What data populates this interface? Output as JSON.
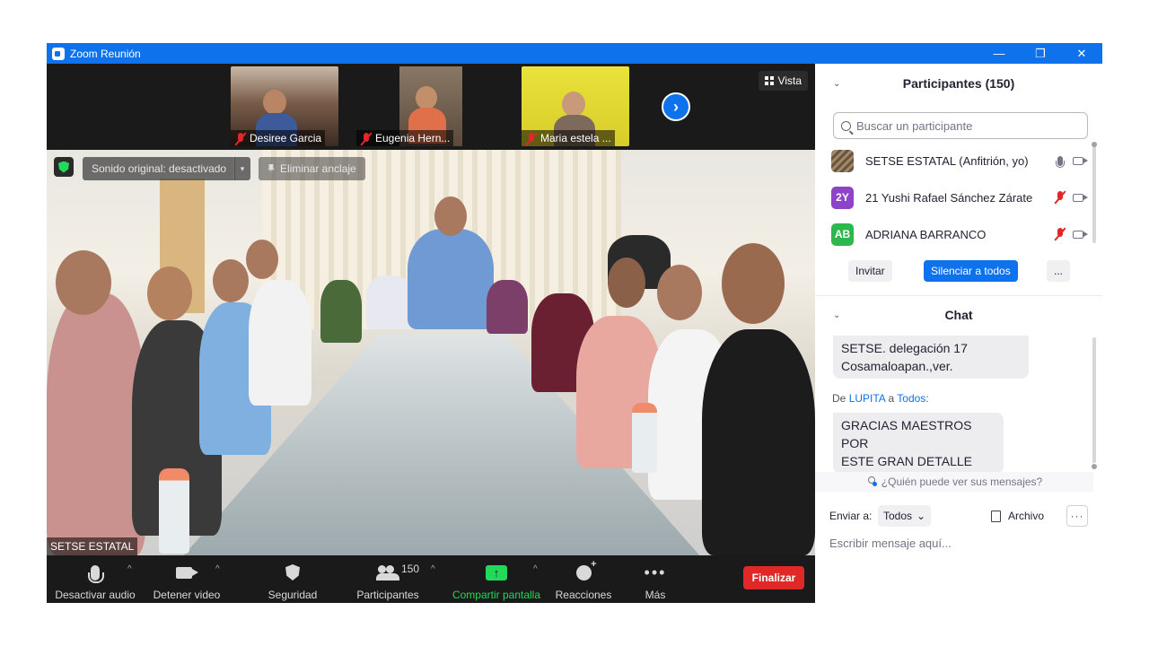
{
  "window": {
    "title": "Zoom Reunión",
    "minimize": "—",
    "maximize": "❐",
    "close": "✕"
  },
  "gallery": {
    "thumbnails": [
      {
        "name": "Desiree Garcia"
      },
      {
        "name": "Eugenia Hern..."
      },
      {
        "name": "Maria estela ..."
      }
    ],
    "view_label": "Vista",
    "next_arrow": "›"
  },
  "video": {
    "sound_label": "Sonido original: desactivado",
    "sound_caret": "▾",
    "unpin_label": "Eliminar anclaje",
    "speaker_name": "SETSE ESTATAL"
  },
  "toolbar": {
    "mute_label": "Desactivar audio",
    "video_label": "Detener video",
    "security_label": "Seguridad",
    "participants_label": "Participantes",
    "participants_count": "150",
    "share_label": "Compartir pantalla",
    "reactions_label": "Reacciones",
    "more_label": "Más",
    "more_glyph": "•••",
    "caret": "^",
    "end_label": "Finalizar"
  },
  "participants_panel": {
    "title": "Participantes (150)",
    "search_placeholder": "Buscar un participante",
    "collapse": "⌄",
    "participants": [
      {
        "avatar": "",
        "name": "SETSE ESTATAL (Anfitrión, yo)",
        "avatar_color": "#5a4a38"
      },
      {
        "avatar": "2Y",
        "name": "21 Yushi Rafael Sánchez Zárate",
        "avatar_color": "#8e44c8"
      },
      {
        "avatar": "AB",
        "name": "ADRIANA BARRANCO",
        "avatar_color": "#2db84d"
      }
    ],
    "invite_label": "Invitar",
    "mute_all_label": "Silenciar a todos",
    "more_label": "..."
  },
  "chat_panel": {
    "title": "Chat",
    "collapse": "⌄",
    "messages": [
      {
        "text_line1": "SETSE. delegación 17",
        "text_line2": "Cosamaloapan.,ver."
      },
      {
        "from_prefix": "De ",
        "from_name": "LUPITA",
        "from_mid": " a ",
        "from_target": "Todos",
        "from_suffix": ":",
        "text_line1": "GRACIAS MAESTROS POR",
        "text_line2": "ESTE GRAN DETALLE"
      }
    ],
    "who_sees": "¿Quién puede ver sus mensajes?",
    "send_to_label": "Enviar a:",
    "send_to_value": "Todos",
    "send_to_caret": "⌄",
    "file_label": "Archivo",
    "more_glyph": "···",
    "compose_placeholder": "Escribir mensaje aquí..."
  },
  "colors": {
    "accent": "#0e72ed",
    "end": "#e02828",
    "share": "#23d959",
    "muted": "#e02828"
  }
}
